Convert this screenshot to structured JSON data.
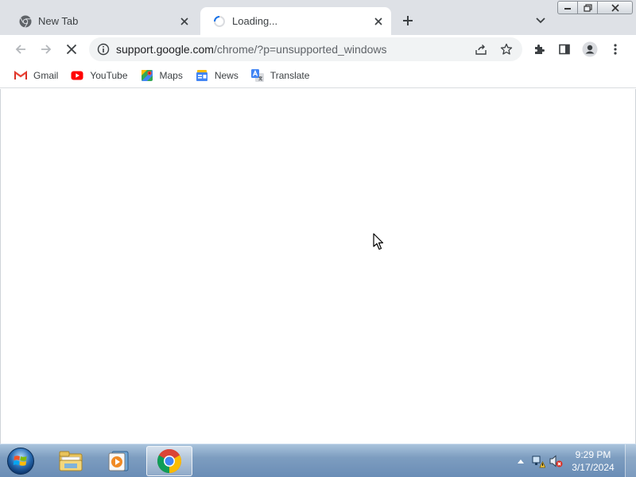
{
  "tabs": [
    {
      "title": "New Tab",
      "favicon": "chrome-icon",
      "active": false
    },
    {
      "title": "Loading...",
      "favicon": "loading-spinner-icon",
      "active": true
    }
  ],
  "toolbar": {
    "url_host": "support.google.com",
    "url_path": "/chrome/?p=unsupported_windows"
  },
  "bookmarks": [
    {
      "label": "Gmail",
      "icon": "gmail-icon"
    },
    {
      "label": "YouTube",
      "icon": "youtube-icon"
    },
    {
      "label": "Maps",
      "icon": "maps-icon"
    },
    {
      "label": "News",
      "icon": "news-icon"
    },
    {
      "label": "Translate",
      "icon": "translate-icon"
    }
  ],
  "taskbar": {
    "apps": [
      "file-explorer",
      "media-player",
      "chrome"
    ],
    "active_app": "chrome",
    "clock_time": "9:29 PM",
    "clock_date": "3/17/2024"
  },
  "colors": {
    "tabstrip": "#dee1e6",
    "omnibox": "#f1f3f4",
    "accent": "#1a73e8"
  }
}
